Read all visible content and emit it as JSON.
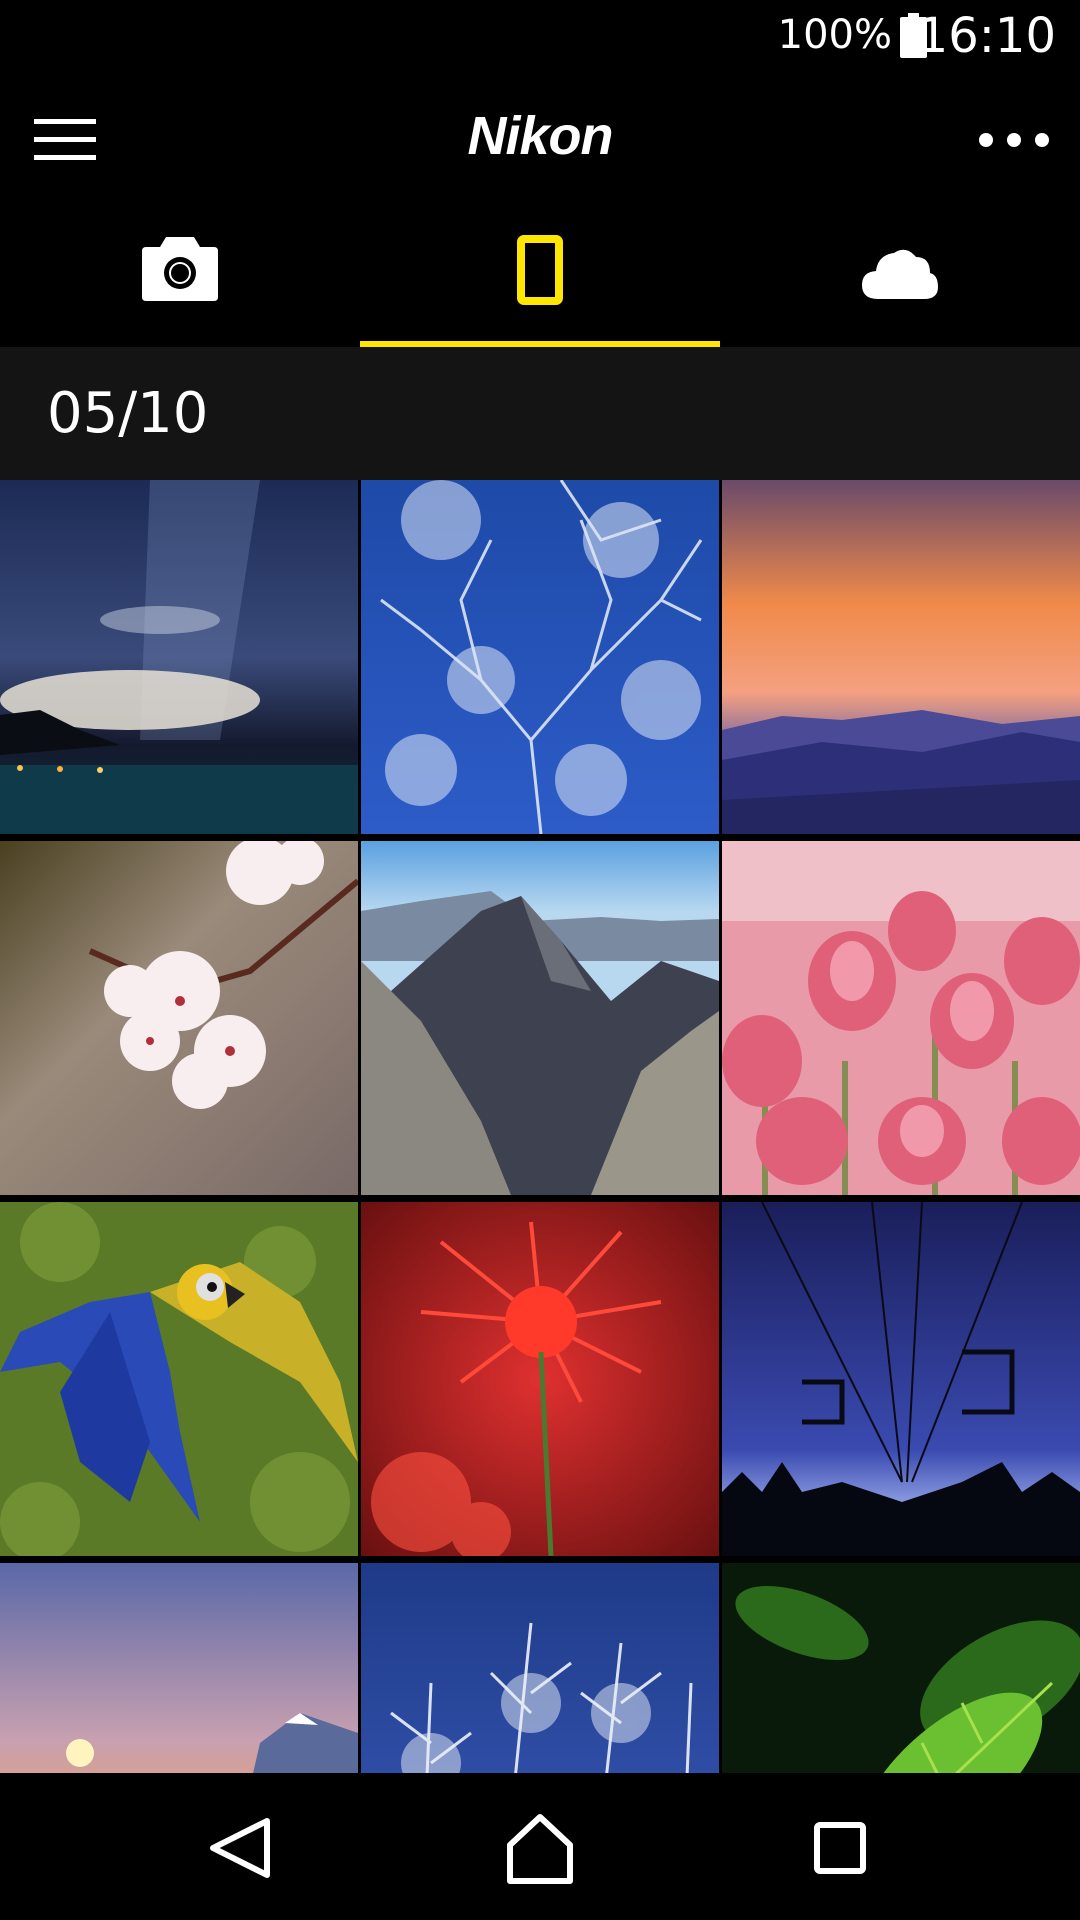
{
  "status_bar": {
    "battery_percent": "100%",
    "time": "16:10"
  },
  "app_bar": {
    "title": "Nikon",
    "menu_icon": "hamburger-menu-icon",
    "more_icon": "more-dots-icon"
  },
  "tabs": [
    {
      "name": "camera",
      "icon": "camera-icon",
      "active": false
    },
    {
      "name": "smart-device",
      "icon": "smartphone-icon",
      "active": true
    },
    {
      "name": "cloud",
      "icon": "cloud-icon",
      "active": false
    }
  ],
  "gallery": {
    "date": "05/10",
    "photos": [
      {
        "subject": "night-sky-milky-way"
      },
      {
        "subject": "frosted-tree-blue-sky"
      },
      {
        "subject": "sunset-mountains"
      },
      {
        "subject": "cherry-blossom"
      },
      {
        "subject": "rocky-mountain-peak"
      },
      {
        "subject": "pink-tulips"
      },
      {
        "subject": "macaw-parrot"
      },
      {
        "subject": "red-spider-lily"
      },
      {
        "subject": "ski-lift-night"
      },
      {
        "subject": "sunset-mount-fuji"
      },
      {
        "subject": "frosted-branches"
      },
      {
        "subject": "green-fern-leaves"
      }
    ]
  },
  "accent_color": "#ffe600",
  "navigation": {
    "back_icon": "back-triangle-icon",
    "home_icon": "home-icon",
    "recents_icon": "recents-square-icon"
  }
}
